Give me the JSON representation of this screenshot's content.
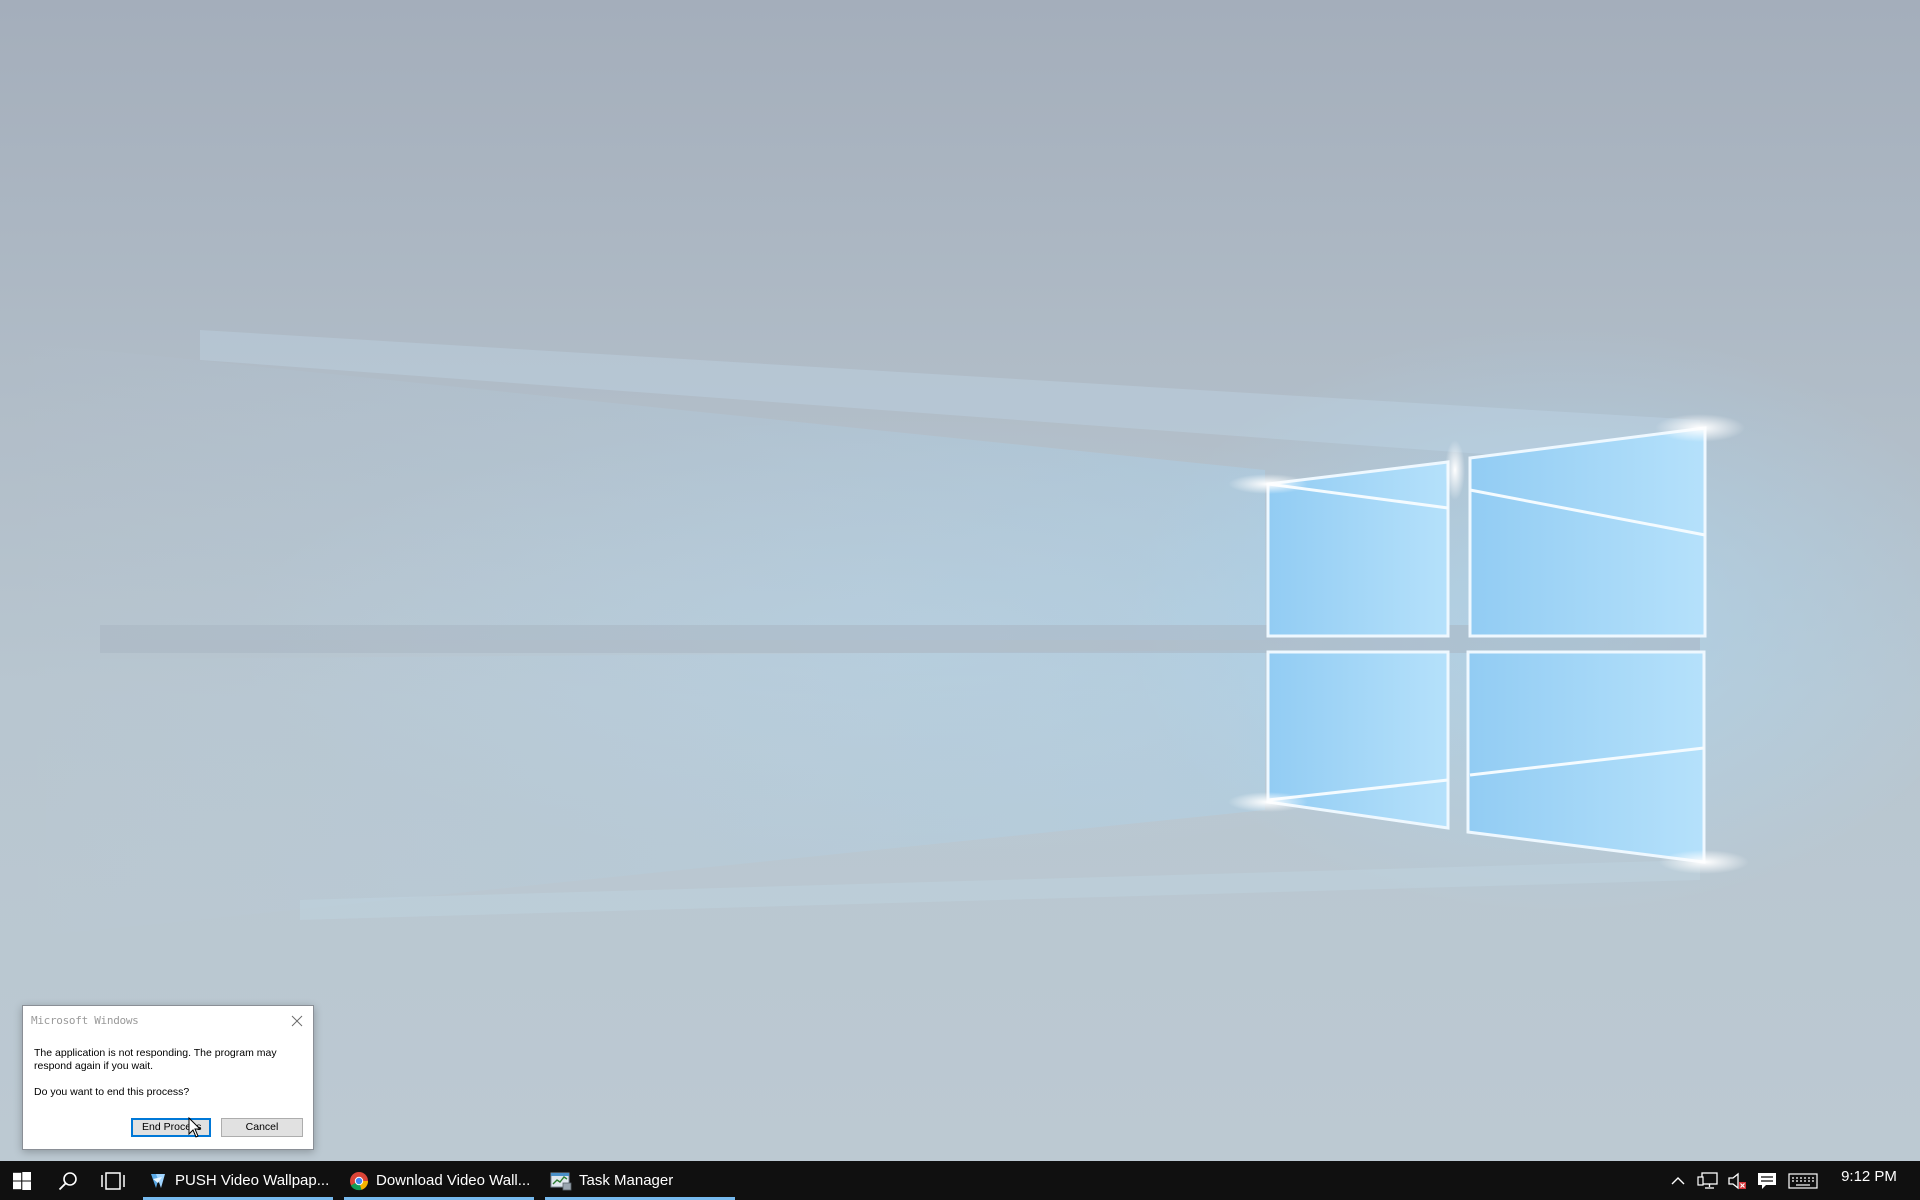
{
  "dialog": {
    "title": "Microsoft Windows",
    "message": "The application is not responding. The program may respond again if you wait.",
    "question": "Do you want to end this process?",
    "end_process_label": "End Process",
    "cancel_label": "Cancel",
    "close_icon": "close-icon"
  },
  "taskbar": {
    "start_icon": "windows-logo-icon",
    "search_icon": "search-icon",
    "task_view_icon": "task-view-icon",
    "apps": [
      {
        "label": "PUSH Video Wallpap...",
        "icon": "push-video-wallpaper-icon",
        "active": true
      },
      {
        "label": "Download Video Wall...",
        "icon": "chrome-icon",
        "active": true
      },
      {
        "label": "Task Manager",
        "icon": "task-manager-icon",
        "active": true
      }
    ],
    "tray": {
      "chevron_icon": "chevron-up-icon",
      "network_icon": "network-icon",
      "volume_icon": "volume-muted-icon",
      "action_center_icon": "action-center-icon",
      "keyboard_icon": "touch-keyboard-icon",
      "clock": "9:12 PM"
    },
    "active_underline_color": "#76b9ed",
    "background_color": "#101010"
  },
  "wallpaper": {
    "description_icon": "windows-10-hero-wallpaper",
    "accent_color": "#8fd0f5"
  }
}
